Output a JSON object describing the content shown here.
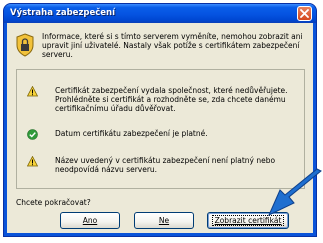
{
  "dialog": {
    "title": "Výstraha zabezpečení",
    "intro": "Informace, které si s tímto serverem vyměníte, nemohou zobrazit ani upravit jiní uživatelé. Nastaly však potíže s certifikátem zabezpečení serveru.",
    "items": [
      {
        "icon": "warning-icon",
        "text": "Certifikát zabezpečení vydala společnost, které nedůvěřujete. Prohlédněte si certifikát a rozhodněte se, zda chcete danému certifikačnímu úřadu důvěřovat."
      },
      {
        "icon": "check-icon",
        "text": "Datum certifikátu zabezpečení je platné."
      },
      {
        "icon": "warning-icon",
        "text": "Název uvedený v certifikátu zabezpečení není platný nebo neodpovídá názvu serveru."
      }
    ],
    "question": "Chcete pokračovat?",
    "buttons": {
      "yes": "Ano",
      "no": "Ne",
      "view_cert": "Zobrazit certifikát"
    }
  },
  "colors": {
    "accent": "#0a53d9",
    "face": "#ece9d8",
    "close": "#d5471d",
    "arrow": "#1f6fd0"
  }
}
